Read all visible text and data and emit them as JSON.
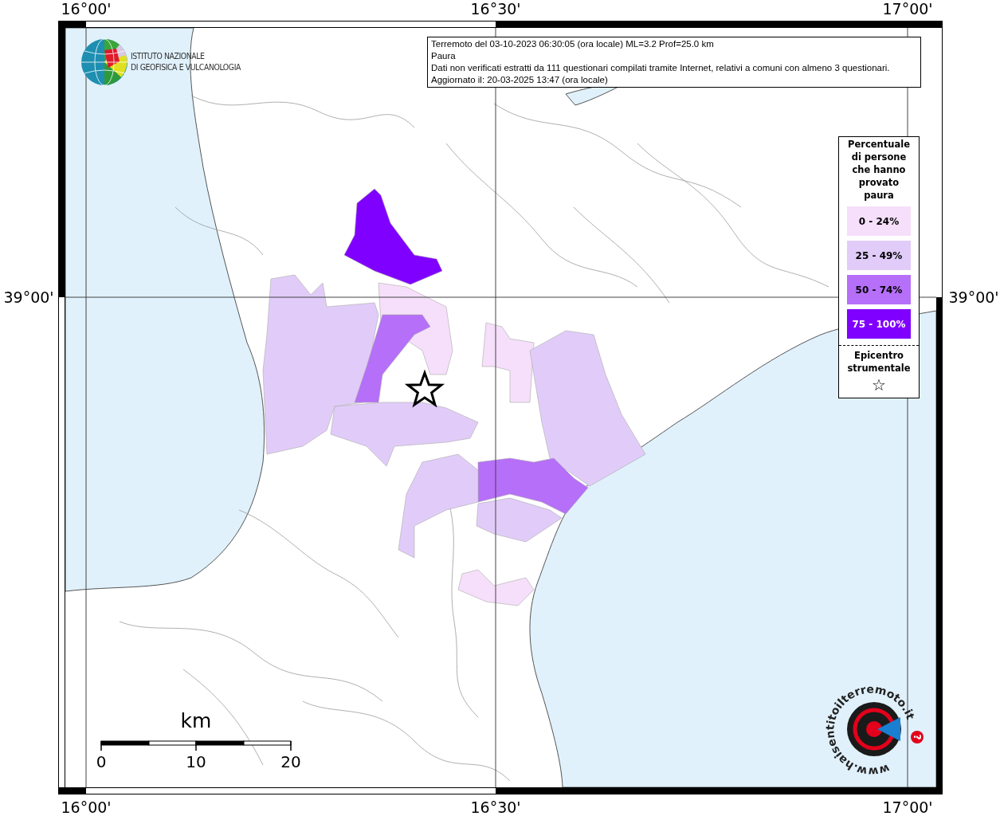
{
  "axis_labels": {
    "top": [
      "16°00'",
      "16°30'",
      "17°00'"
    ],
    "bottom": [
      "16°00'",
      "16°30'",
      "17°00'"
    ],
    "left": [
      "39°00'"
    ],
    "right": [
      "39°00'"
    ]
  },
  "institute_logo": {
    "lines": [
      "ISTITUTO NAZIONALE",
      "DI GEOFISICA E VULCANOLOGIA"
    ]
  },
  "info_box": {
    "lines": [
      "Terremoto del 03-10-2023 06:30:05 (ora locale) ML=3.2 Prof=25.0 km",
      "Paura",
      "Dati non verificati estratti da 111 questionari compilati tramite Internet, relativi a comuni con almeno 3 questionari.",
      "Aggiornato il: 20-03-2025 13:47 (ora locale)"
    ]
  },
  "legend": {
    "title_lines": [
      "Percentuale",
      "di persone",
      "che hanno",
      "provato",
      "paura"
    ],
    "classes": [
      {
        "label": "0 - 24%",
        "color": "#f6dffa"
      },
      {
        "label": "25 - 49%",
        "color": "#e1ccf9"
      },
      {
        "label": "50 - 74%",
        "color": "#b66ff8"
      },
      {
        "label": "75 - 100%",
        "color": "#7f00ff"
      }
    ],
    "epicenter_lines": [
      "Epicentro",
      "strumentale"
    ],
    "epicenter_symbol": "☆"
  },
  "areas": [
    {
      "color": "#7f00ff"
    },
    {
      "color": "#e1ccf9"
    },
    {
      "color": "#f6dffa"
    },
    {
      "color": "#b66ff8"
    },
    {
      "color": "#e1ccf9"
    },
    {
      "color": "#f6dffa"
    },
    {
      "color": "#e1ccf9"
    },
    {
      "color": "#b66ff8"
    },
    {
      "color": "#e1ccf9"
    },
    {
      "color": "#e1ccf9"
    },
    {
      "color": "#f6dffa"
    }
  ],
  "scale_bar": {
    "unit": "km",
    "ticks": [
      "0",
      "10",
      "20"
    ]
  },
  "site_logo": {
    "text": "www.haisentitoilterremoto.it",
    "badge": "?"
  }
}
